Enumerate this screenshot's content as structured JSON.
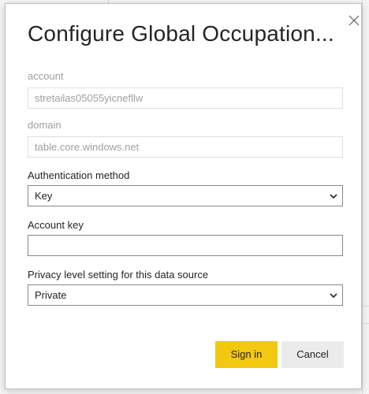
{
  "dialog": {
    "title": "Configure Global Occupation...",
    "close_icon": "close-icon"
  },
  "fields": {
    "account": {
      "label": "account",
      "value": "stretailas05055yicnefllw",
      "disabled": true
    },
    "domain": {
      "label": "domain",
      "value": "table.core.windows.net",
      "disabled": true
    },
    "auth_method": {
      "label": "Authentication method",
      "value": "Key"
    },
    "account_key": {
      "label": "Account key",
      "value": ""
    },
    "privacy": {
      "label": "Privacy level setting for this data source",
      "value": "Private"
    }
  },
  "buttons": {
    "sign_in": "Sign in",
    "cancel": "Cancel"
  },
  "colors": {
    "primary_button": "#f2c811",
    "secondary_button": "#ebebeb",
    "disabled_text": "#a19f9d"
  }
}
